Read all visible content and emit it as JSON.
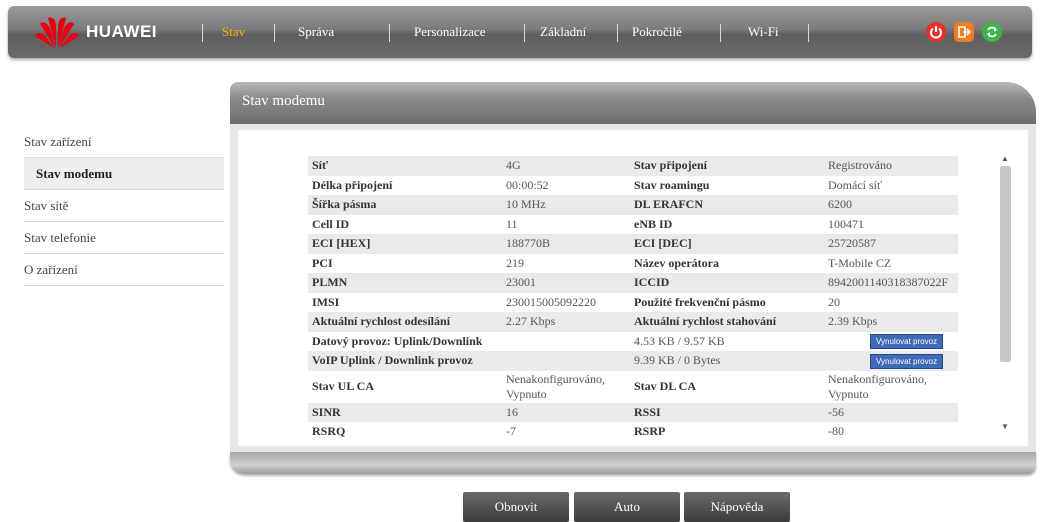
{
  "brand": {
    "logo_text": "HUAWEI"
  },
  "nav": {
    "items": [
      {
        "label": "Stav",
        "active": true
      },
      {
        "label": "Správa"
      },
      {
        "label": "Personalizace"
      },
      {
        "label": "Základní"
      },
      {
        "label": "Pokročilé"
      },
      {
        "label": "Wi-Fi"
      }
    ]
  },
  "top_icons": [
    {
      "name": "power-icon",
      "color": "#e8312a"
    },
    {
      "name": "logout-icon",
      "color": "#f47b20"
    },
    {
      "name": "refresh-icon",
      "color": "#3bb54a"
    }
  ],
  "sidebar": {
    "items": [
      {
        "label": "Stav zařízení"
      },
      {
        "label": "Stav modemu",
        "active": true
      },
      {
        "label": "Stav sítě"
      },
      {
        "label": "Stav telefonie"
      },
      {
        "label": "O zařízení"
      }
    ]
  },
  "panel": {
    "title": "Stav modemu",
    "rows": [
      {
        "l1": "Síť",
        "v1": "4G",
        "l2": "Stav připojení",
        "v2": "Registrováno"
      },
      {
        "l1": "Délka připojení",
        "v1": "00:00:52",
        "l2": "Stav roamingu",
        "v2": "Domácí síť"
      },
      {
        "l1": "Šířka pásma",
        "v1": "10 MHz",
        "l2": "DL ERAFCN",
        "v2": "6200"
      },
      {
        "l1": "Cell ID",
        "v1": "11",
        "l2": "eNB ID",
        "v2": "100471"
      },
      {
        "l1": "ECI [HEX]",
        "v1": "188770B",
        "l2": "ECI [DEC]",
        "v2": "25720587"
      },
      {
        "l1": "PCI",
        "v1": "219",
        "l2": "Název operátora",
        "v2": "T-Mobile CZ"
      },
      {
        "l1": "PLMN",
        "v1": "23001",
        "l2": "ICCID",
        "v2": "8942001140318387022F"
      },
      {
        "l1": "IMSI",
        "v1": "230015005092220",
        "l2": "Použité frekvenční pásmo",
        "v2": "20"
      },
      {
        "l1": "Aktuální rychlost odesílání",
        "v1": "2.27 Kbps",
        "l2": "Aktuální rychlost stahování",
        "v2": "2.39 Kbps"
      },
      {
        "l1": "Datový provoz: Uplink/Downlink",
        "v1": "",
        "l2": "4.53 KB / 9.57 KB",
        "v2": "Vynulovat provoz"
      },
      {
        "l1": "VoIP Uplink / Downlink provoz",
        "v1": "",
        "l2": "9.39 KB / 0 Bytes",
        "v2": "Vynulovat provoz"
      },
      {
        "l1": "Stav UL CA",
        "v1": "Nenakonfigurováno, Vypnuto",
        "l2": "Stav DL CA",
        "v2": "Nenakonfigurováno, Vypnuto"
      },
      {
        "l1": "SINR",
        "v1": "16",
        "l2": "RSSI",
        "v2": "-56"
      },
      {
        "l1": "RSRQ",
        "v1": "-7",
        "l2": "RSRP",
        "v2": "-80"
      }
    ]
  },
  "buttons": {
    "refresh": "Obnovit",
    "auto": "Auto",
    "help": "Nápověda"
  }
}
